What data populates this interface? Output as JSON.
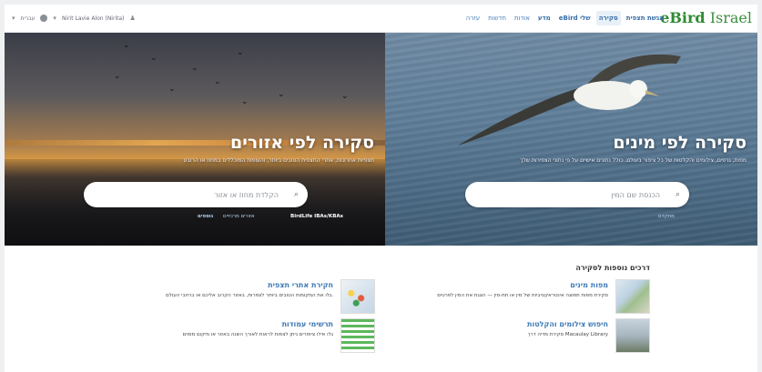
{
  "header": {
    "logo_part1": "eBird",
    "logo_part2": "Israel",
    "nav": [
      "הגשת תצפית",
      "סקירה",
      "eBird שלי",
      "מדע",
      "אודות",
      "חדשות",
      "עזרה"
    ],
    "user_name": "Nirit Lavie Alon (Nirita)",
    "language": "עברית"
  },
  "hero_species": {
    "title": "סקירה לפי מינים",
    "description": "מפות, גרפים, צילומים והקלטות של כל ציפור בעולם. כולל נתונים אישיים על פי נתוני הצפירות שלך",
    "search_placeholder": "הכנסת שם המין",
    "link": "מתקדם"
  },
  "hero_regions": {
    "title": "סקירה לפי אזורים",
    "description": "תצפיות אחרונות, אתרי התצפית הטובים ביותר, והעופות המוכללים במחוז או הרובע",
    "search_placeholder": "הקלדת מחוז או אזור",
    "link_ibas": "BirdLife IBAs/KBAs",
    "link_areas": "אזורים מרכזיים",
    "link_more": "נוספים"
  },
  "more": {
    "title": "דרכים נוספות לסקירה",
    "cards": [
      {
        "title": "מפות מינים",
        "desc": "סקירת מפות תפוצה אינטראקטיביות של מין או תת-מין — הצגת את המין לפרטים"
      },
      {
        "title": "חיפוש צילומים והקלטות",
        "desc": "סקירת מדיה דרך Macaulay Library"
      },
      {
        "title": "חקירת אתרי תצפית",
        "desc": "גלו את המקומות הטובים ביותר לצפרות, באזור הקרוב אליכם או ברחבי העולם."
      },
      {
        "title": "תרשימי עמודות",
        "desc": "גלו אילו ציפורים ניתן לצפות לראות לאורך השנה באזור או מיקום מסוים"
      }
    ]
  }
}
